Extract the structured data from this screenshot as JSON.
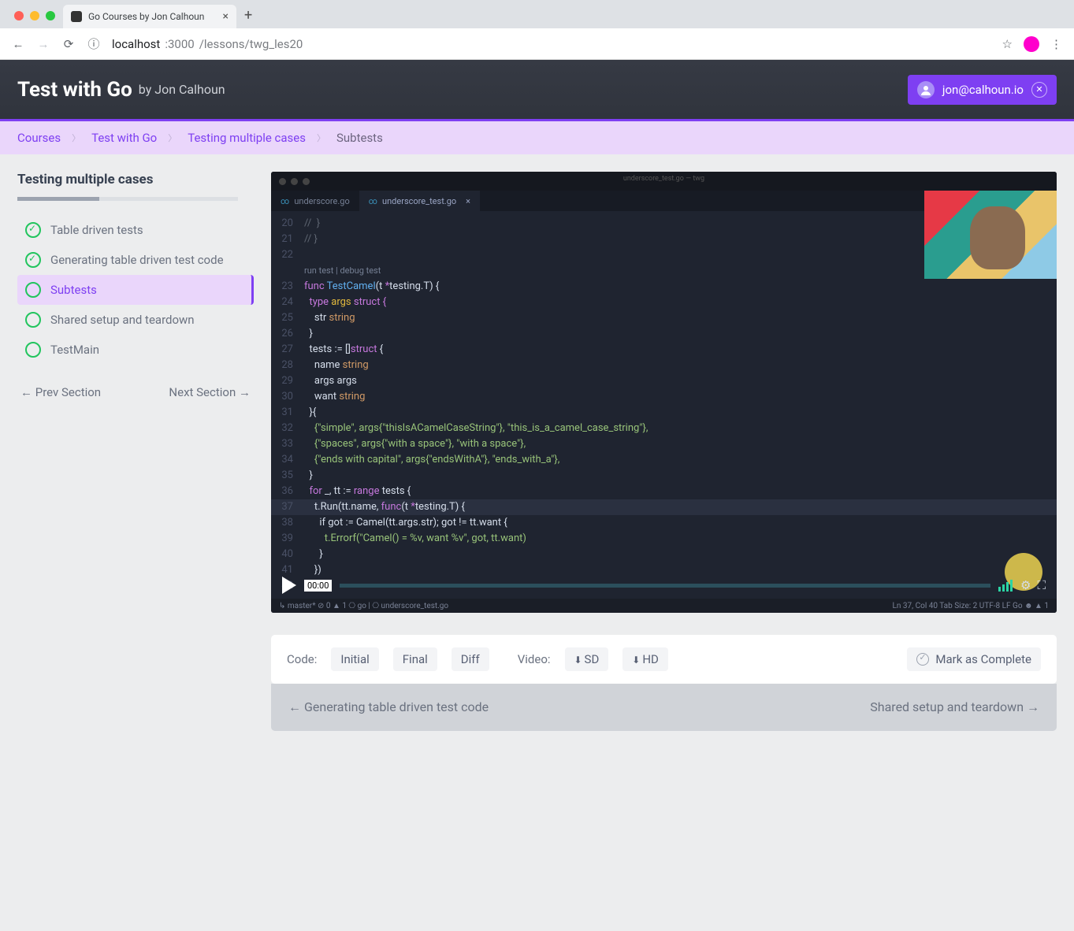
{
  "browser": {
    "tab_title": "Go Courses by Jon Calhoun",
    "url_host": "localhost",
    "url_port": ":3000",
    "url_path": "/lessons/twg_les20"
  },
  "header": {
    "title": "Test with Go",
    "subtitle": "by Jon Calhoun",
    "user_email": "jon@calhoun.io"
  },
  "breadcrumbs": [
    "Courses",
    "Test with Go",
    "Testing multiple cases",
    "Subtests"
  ],
  "sidebar": {
    "section_title": "Testing multiple cases",
    "items": [
      {
        "label": "Table driven tests",
        "done": true,
        "active": false
      },
      {
        "label": "Generating table driven test code",
        "done": true,
        "active": false
      },
      {
        "label": "Subtests",
        "done": false,
        "active": true
      },
      {
        "label": "Shared setup and teardown",
        "done": false,
        "active": false
      },
      {
        "label": "TestMain",
        "done": false,
        "active": false
      }
    ],
    "prev": "Prev Section",
    "next": "Next Section"
  },
  "video": {
    "title_bar": "underscore_test.go — twg",
    "tab1": "underscore.go",
    "tab2": "underscore_test.go",
    "runtest": "run test | debug test",
    "time": "00:00",
    "status_left": "↳ master*    ⊘ 0 ▲ 1   ⎔ go | ⎔ underscore_test.go",
    "status_right": "Ln 37, Col 40   Tab Size: 2   UTF-8   LF   Go   ☻ ▲ 1",
    "lines": {
      "l20": "//  }",
      "l21": "// }",
      "l22": "",
      "l23a": "func ",
      "l23b": "TestCamel",
      "l23c": "(t ",
      "l23d": "*",
      "l23e": "testing.T) {",
      "l24": "  type ",
      "l24b": "args ",
      "l24c": "struct {",
      "l25": "    str ",
      "l25b": "string",
      "l26": "  }",
      "l27": "  tests := []",
      "l27b": "struct ",
      "l27c": "{",
      "l28": "    name ",
      "l28b": "string",
      "l29": "    args args",
      "l30": "    want ",
      "l30b": "string",
      "l31": "  }{",
      "l32": "    {\"simple\", args{\"thisIsACamelCaseString\"}, \"this_is_a_camel_case_string\"},",
      "l33": "    {\"spaces\", args{\"with a space\"}, \"with a space\"},",
      "l34": "    {\"ends with capital\", args{\"endsWithA\"}, \"ends_with_a\"},",
      "l35": "  }",
      "l36": "  for ",
      "l36b": "_, tt := ",
      "l36c": "range ",
      "l36d": "tests {",
      "l37": "    t.Run(tt.name, ",
      "l37b": "func",
      "l37c": "(t ",
      "l37d": "*",
      "l37e": "testing.T) {",
      "l38": "      if got := Camel(tt.args.str); got != tt.want {",
      "l39": "        t.Errorf(\"Camel() = %v, want %v\", got, tt.want)",
      "l40": "      }",
      "l41": "    })",
      "l42": "  }"
    }
  },
  "toolbar": {
    "code_label": "Code:",
    "initial": "Initial",
    "final": "Final",
    "diff": "Diff",
    "video_label": "Video:",
    "sd": "SD",
    "hd": "HD",
    "mark": "Mark as Complete"
  },
  "lessnav": {
    "prev": "Generating table driven test code",
    "next": "Shared setup and teardown"
  }
}
